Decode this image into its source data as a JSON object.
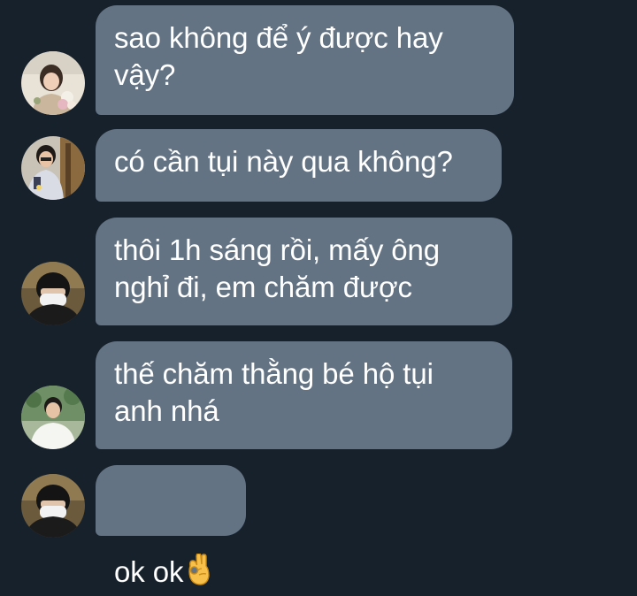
{
  "chat": {
    "messages": [
      {
        "text": "sao không để ý được hay\nvậy?",
        "avatar": "avatar-girl-flowers"
      },
      {
        "text": "có cần tụi này qua không?",
        "avatar": "avatar-boy-selfie"
      },
      {
        "text": "thôi 1h sáng rồi, mấy ông\nnghỉ đi, em chăm được",
        "avatar": "avatar-masked-boy"
      },
      {
        "text": "thế chăm thằng bé hộ tụi\nanh nhá",
        "avatar": "avatar-boy-white-shirt"
      },
      {
        "text": "ok ok",
        "avatar": "avatar-masked-boy",
        "emoji": "ok-hand-emoji"
      }
    ]
  },
  "colors": {
    "background": "#17212b",
    "bubble": "#637384",
    "text": "#ffffff"
  }
}
